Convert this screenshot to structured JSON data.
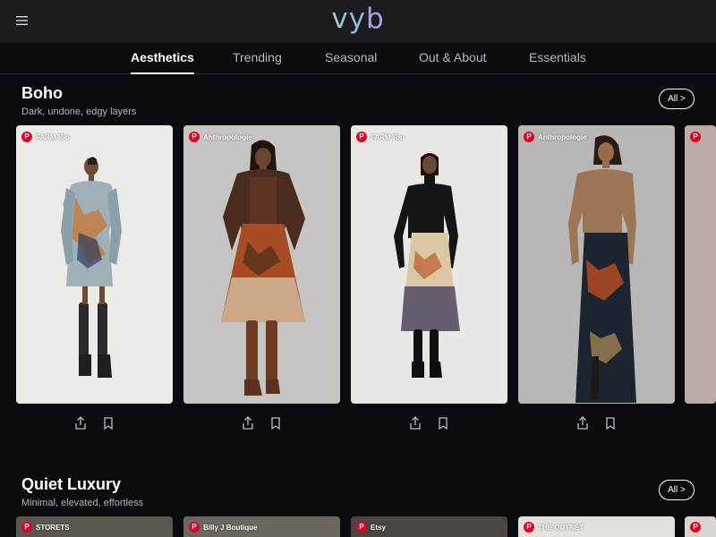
{
  "app": {
    "logo": "vyb"
  },
  "icons": {
    "menu": "hamburger-menu-icon",
    "share": "share-icon",
    "save": "bookmark-icon",
    "source": "pinterest-icon"
  },
  "tabs": [
    {
      "label": "Aesthetics",
      "active": true
    },
    {
      "label": "Trending",
      "active": false
    },
    {
      "label": "Seasonal",
      "active": false
    },
    {
      "label": "Out & About",
      "active": false
    },
    {
      "label": "Essentials",
      "active": false
    }
  ],
  "sections": [
    {
      "title": "Boho",
      "subtitle": "Dark, undone, edgy layers",
      "all_label": "All >",
      "cards": [
        {
          "source": "FARM Rio"
        },
        {
          "source": "Anthropologie"
        },
        {
          "source": "FARM Rio"
        },
        {
          "source": "Anthropologie"
        }
      ]
    },
    {
      "title": "Quiet Luxury",
      "subtitle": "Minimal, elevated, effortless",
      "all_label": "All >",
      "cards": [
        {
          "source": "STORETS"
        },
        {
          "source": "Billy J Boutique"
        },
        {
          "source": "Etsy"
        },
        {
          "source": "THE OUTNET"
        }
      ]
    }
  ],
  "colors": {
    "background": "#0b0a0f",
    "topbar": "#1c1b20",
    "pinterest": "#e60023"
  }
}
